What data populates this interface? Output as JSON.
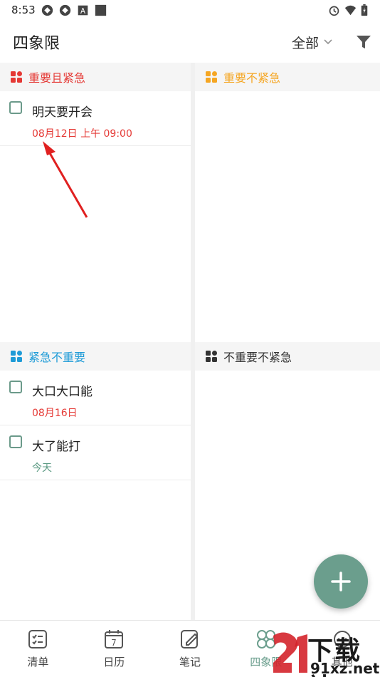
{
  "status_bar": {
    "time": "8:53",
    "left_icons": [
      "sync-icon",
      "sync-icon",
      "a-icon",
      "square-icon"
    ],
    "right_icons": [
      "alarm-icon",
      "wifi-icon",
      "battery-icon"
    ]
  },
  "header": {
    "title": "四象限",
    "filter_label": "全部",
    "filter_icon": "funnel-icon"
  },
  "quadrants": [
    {
      "id": "important-urgent",
      "title": "重要且紧急",
      "color": "#e53935",
      "tasks": [
        {
          "title": "明天要开会",
          "date": "08月12日 上午 09:00",
          "date_color": "#e53935"
        }
      ]
    },
    {
      "id": "important-not-urgent",
      "title": "重要不紧急",
      "color": "#f5a623",
      "tasks": []
    },
    {
      "id": "urgent-not-important",
      "title": "紧急不重要",
      "color": "#1e9bd7",
      "tasks": [
        {
          "title": "大口大口能",
          "date": "08月16日",
          "date_color": "#e53935"
        },
        {
          "title": "大了能打",
          "date": "今天",
          "date_color": "#5d9b84"
        }
      ]
    },
    {
      "id": "not-important-not-urgent",
      "title": "不重要不紧急",
      "color": "#333333",
      "tasks": []
    }
  ],
  "bottom_nav": [
    {
      "label": "清单",
      "icon": "checklist-icon"
    },
    {
      "label": "日历",
      "icon": "calendar-icon",
      "day": "7"
    },
    {
      "label": "笔记",
      "icon": "note-icon"
    },
    {
      "label": "四象限",
      "icon": "quadrant-icon",
      "active": true
    },
    {
      "label": "其他",
      "icon": "more-icon"
    }
  ],
  "watermark": {
    "line1": "下载站",
    "line2": "91xz.net"
  },
  "colors": {
    "accent": "#6b9e8d",
    "urgent_red": "#e53935"
  }
}
